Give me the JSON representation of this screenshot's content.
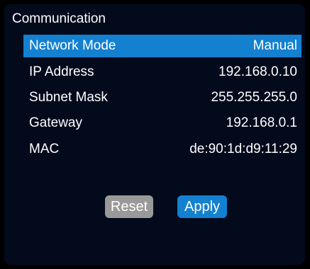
{
  "panel": {
    "title": "Communication"
  },
  "settings": [
    {
      "label": "Network Mode",
      "value": "Manual",
      "selected": true
    },
    {
      "label": "IP Address",
      "value": "192.168.0.10",
      "selected": false
    },
    {
      "label": "Subnet Mask",
      "value": "255.255.255.0",
      "selected": false
    },
    {
      "label": "Gateway",
      "value": "192.168.0.1",
      "selected": false
    },
    {
      "label": "MAC",
      "value": "de:90:1d:d9:11:29",
      "selected": false
    }
  ],
  "buttons": {
    "reset_label": "Reset",
    "apply_label": "Apply"
  },
  "colors": {
    "background": "#020a1c",
    "selection": "#1480d0",
    "reset_button": "#999999",
    "apply_button": "#1480d0",
    "text": "#ffffff"
  }
}
